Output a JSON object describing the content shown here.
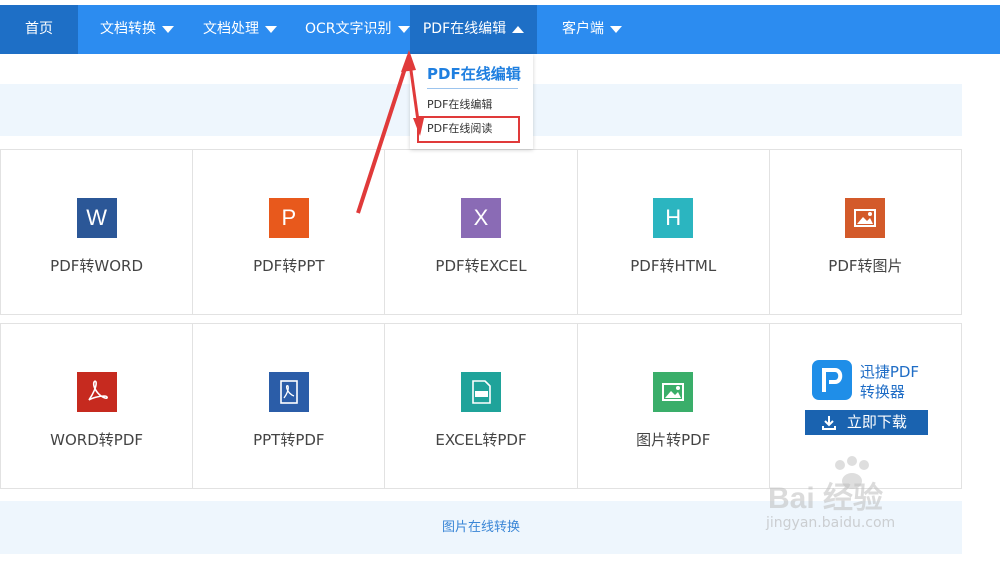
{
  "nav": {
    "items": [
      {
        "label": "首页"
      },
      {
        "label": "文档转换"
      },
      {
        "label": "文档处理"
      },
      {
        "label": "OCR文字识别"
      },
      {
        "label": "PDF在线编辑"
      },
      {
        "label": "客户端"
      }
    ]
  },
  "dropdown": {
    "title": "PDF在线编辑",
    "items": [
      {
        "label": "PDF在线编辑"
      },
      {
        "label": "PDF在线阅读"
      }
    ]
  },
  "tools_row1": [
    {
      "label": "PDF转WORD",
      "glyph": "W",
      "color": "#2b5797",
      "icon": "word-icon"
    },
    {
      "label": "PDF转PPT",
      "glyph": "P",
      "color": "#e8591c",
      "icon": "ppt-icon"
    },
    {
      "label": "PDF转EXCEL",
      "glyph": "X",
      "color": "#8a6bb5",
      "icon": "excel-icon"
    },
    {
      "label": "PDF转HTML",
      "glyph": "H",
      "color": "#2bb5c0",
      "icon": "html-icon"
    },
    {
      "label": "PDF转图片",
      "glyph": "",
      "color": "#d35a2a",
      "icon": "image-icon"
    }
  ],
  "tools_row2": [
    {
      "label": "WORD转PDF",
      "glyph": "",
      "color": "#c62a1f",
      "icon": "acrobat-icon"
    },
    {
      "label": "PPT转PDF",
      "glyph": "",
      "color": "#2b5da8",
      "icon": "pdf-file-icon"
    },
    {
      "label": "EXCEL转PDF",
      "glyph": "",
      "color": "#1fa39a",
      "icon": "pdf-sheet-icon"
    },
    {
      "label": "图片转PDF",
      "glyph": "",
      "color": "#3aae6a",
      "icon": "picture-icon"
    }
  ],
  "promo": {
    "name_line1": "迅捷PDF",
    "name_line2": "转换器",
    "download_label": "立即下载"
  },
  "bottom_band": {
    "label": "图片在线转换"
  },
  "watermark": {
    "brand": "Bai 经验",
    "url": "jingyan.baidu.com"
  },
  "colors": {
    "nav_bg": "#2c8cf0",
    "nav_active": "#1e6fc6",
    "annotation": "#e03a3a"
  }
}
